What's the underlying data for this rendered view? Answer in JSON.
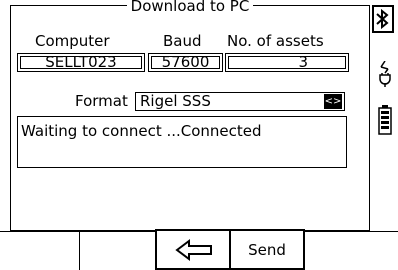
{
  "panel": {
    "title": "Download to PC"
  },
  "fields": {
    "computer": {
      "label": "Computer",
      "value": "SELLT023"
    },
    "baud": {
      "label": "Baud",
      "value": "57600"
    },
    "assets": {
      "label": "No. of assets",
      "value": "3"
    }
  },
  "format": {
    "label": "Format",
    "value": "Rigel SSS",
    "arrow_icon": "up-down-arrows-icon"
  },
  "status": {
    "text": "Waiting to connect ...Connected"
  },
  "side_icons": [
    "bluetooth-icon",
    "plug-icon",
    "battery-icon"
  ],
  "softkeys": {
    "back_icon": "left-arrow-icon",
    "send_label": "Send"
  }
}
